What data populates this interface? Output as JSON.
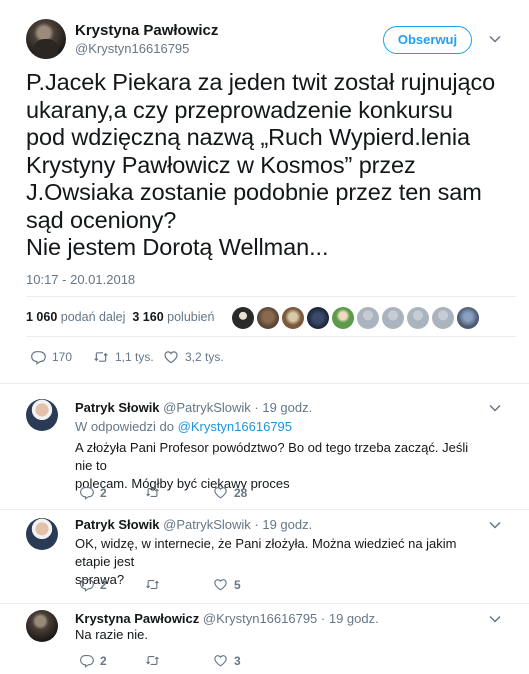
{
  "main_tweet": {
    "author_name": "Krystyna Pawłowicz",
    "author_handle": "@Krystyn16616795",
    "follow_label": "Obserwuj",
    "text_lines": [
      "P.Jacek Piekara za jeden twit został rujnująco",
      "ukarany,a czy przeprowadzenie konkursu",
      "pod wdzięczną nazwą „Ruch Wypierd.lenia",
      "Krystyny Pawłowicz w Kosmos” przez",
      "J.Owsiaka zostanie podobnie przez ten sam",
      "sąd oceniony?",
      "Nie jestem Dorotą Wellman..."
    ],
    "timestamp": "10:17 - 20.01.2018",
    "retweets_count": "1 060",
    "retweets_label": "podań dalej",
    "likes_count": "3 160",
    "likes_label": "polubień",
    "replies": "170",
    "retweets_short": "1,1 tys.",
    "likes_short": "3,2 tys."
  },
  "replies": [
    {
      "name": "Patryk Słowik",
      "handle": "@PatrykSlowik",
      "time": "· 19 godz.",
      "replying_prefix": "W odpowiedzi do",
      "replying_to": "@Krystyn16616795",
      "text_lines": [
        "A złożyła Pani Profesor powództwo? Bo od tego trzeba zacząć. Jeśli nie to",
        "polecam. Mógłby być ciekawy proces"
      ],
      "reply_count": "2",
      "retweet_count": "",
      "like_count": "28"
    },
    {
      "name": "Patryk Słowik",
      "handle": "@PatrykSlowik",
      "time": "· 19 godz.",
      "text_lines": [
        "OK, widzę, w internecie, że Pani złożyła. Można wiedzieć na jakim etapie jest",
        "sprawa?"
      ],
      "reply_count": "2",
      "retweet_count": "",
      "like_count": "5"
    },
    {
      "name": "Krystyna Pawłowicz",
      "handle": "@Krystyn16616795",
      "time": "· 19 godz.",
      "text_lines": [
        "Na razie nie."
      ],
      "reply_count": "2",
      "retweet_count": "",
      "like_count": "3"
    }
  ],
  "icons": {
    "reply": "reply-icon",
    "retweet": "retweet-icon",
    "like": "heart-icon",
    "more": "chevron-down-icon"
  },
  "colors": {
    "accent": "#1da1f2",
    "link": "#1b95e0",
    "muted": "#657786",
    "text": "#14171a",
    "divider": "#e6ecf0"
  }
}
